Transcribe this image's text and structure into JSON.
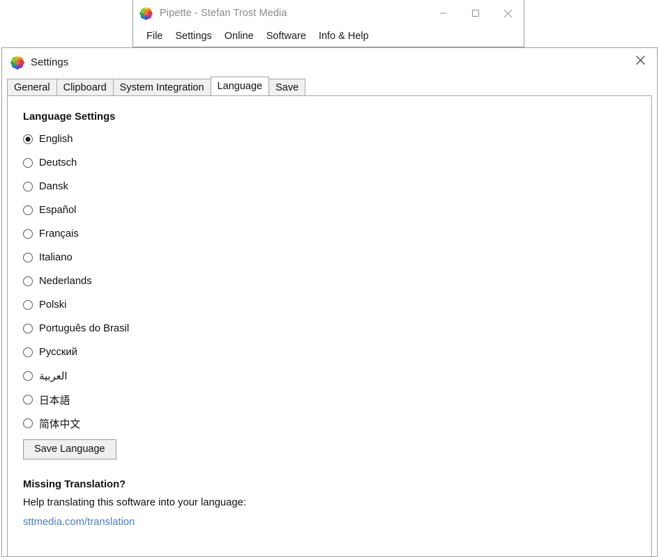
{
  "background_window": {
    "title": "Pipette - Stefan Trost Media",
    "icon": "color-flower-icon",
    "controls": {
      "minimize": "minimize-icon",
      "maximize": "maximize-icon",
      "close": "close-icon"
    },
    "menu": [
      {
        "label": "File"
      },
      {
        "label": "Settings"
      },
      {
        "label": "Online"
      },
      {
        "label": "Software"
      },
      {
        "label": "Info & Help"
      }
    ]
  },
  "settings_window": {
    "title": "Settings",
    "icon": "color-flower-icon",
    "close_icon": "close-icon",
    "tabs": [
      {
        "label": "General",
        "active": false
      },
      {
        "label": "Clipboard",
        "active": false
      },
      {
        "label": "System Integration",
        "active": false
      },
      {
        "label": "Language",
        "active": true
      },
      {
        "label": "Save",
        "active": false
      }
    ],
    "language_tab": {
      "heading": "Language Settings",
      "selected": "English",
      "options": [
        {
          "label": "English",
          "checked": true
        },
        {
          "label": "Deutsch",
          "checked": false
        },
        {
          "label": "Dansk",
          "checked": false
        },
        {
          "label": "Español",
          "checked": false
        },
        {
          "label": "Français",
          "checked": false
        },
        {
          "label": "Italiano",
          "checked": false
        },
        {
          "label": "Nederlands",
          "checked": false
        },
        {
          "label": "Polski",
          "checked": false
        },
        {
          "label": "Português do Brasil",
          "checked": false
        },
        {
          "label": "Русский",
          "checked": false
        },
        {
          "label": "العربية",
          "checked": false
        },
        {
          "label": "日本語",
          "checked": false
        },
        {
          "label": "简体中文",
          "checked": false
        }
      ],
      "save_button": "Save Language",
      "missing_heading": "Missing Translation?",
      "missing_text": "Help translating this software into your language:",
      "missing_link": "sttmedia.com/translation"
    }
  },
  "colors": {
    "link": "#4a7ebb",
    "window_border": "#a0a0a0",
    "tab_inactive_bg": "#f0f0f0",
    "button_bg": "#f0f0f0",
    "title_inactive_text": "#8a8a8a"
  }
}
